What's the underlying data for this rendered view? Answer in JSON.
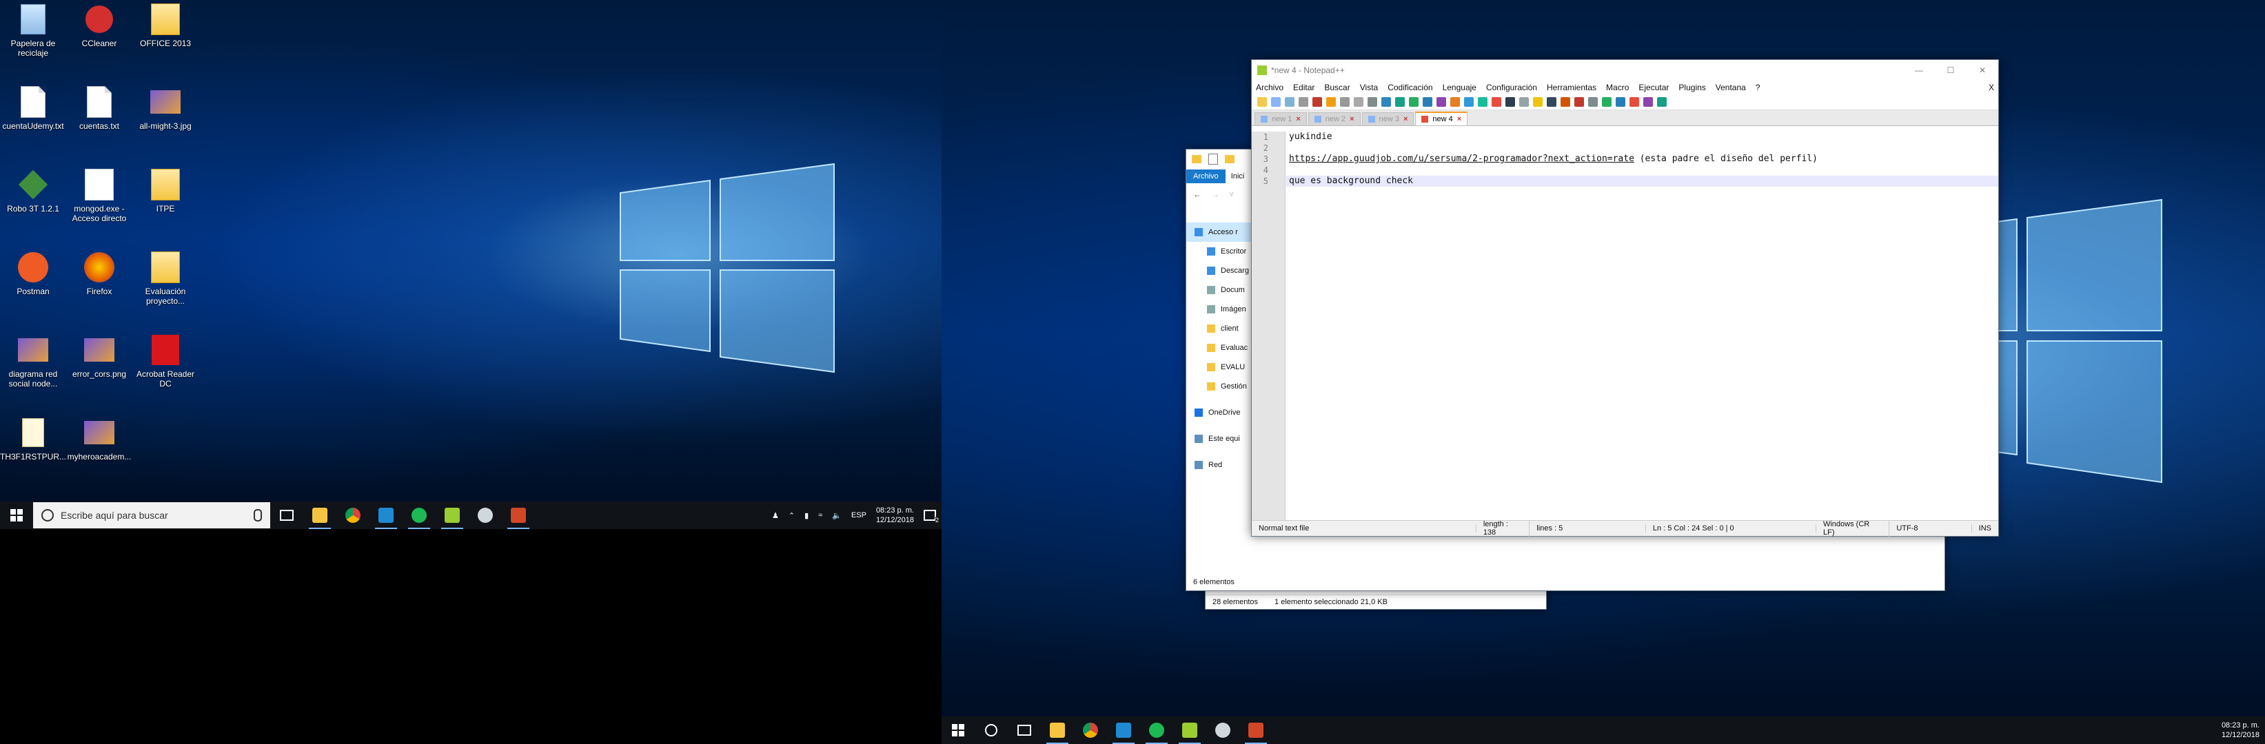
{
  "desktop1": {
    "icons": [
      {
        "label": "Papelera de reciclaje",
        "icon": "recycle-bin-icon"
      },
      {
        "label": "CCleaner",
        "icon": "ccleaner-icon"
      },
      {
        "label": "OFFICE 2013",
        "icon": "folder-icon"
      },
      {
        "label": "cuentaUdemy.txt",
        "icon": "text-file-icon"
      },
      {
        "label": "cuentas.txt",
        "icon": "text-file-icon"
      },
      {
        "label": "all-might-3.jpg",
        "icon": "image-file-icon"
      },
      {
        "label": "Robo 3T 1.2.1",
        "icon": "robo3t-icon"
      },
      {
        "label": "mongod.exe - Acceso directo",
        "icon": "mongodb-icon"
      },
      {
        "label": "ITPE",
        "icon": "folder-icon"
      },
      {
        "label": "Postman",
        "icon": "postman-icon"
      },
      {
        "label": "Firefox",
        "icon": "firefox-icon"
      },
      {
        "label": "Evaluación proyecto...",
        "icon": "folder-icon"
      },
      {
        "label": "diagrama red social node...",
        "icon": "image-file-icon"
      },
      {
        "label": "error_cors.png",
        "icon": "image-file-icon"
      },
      {
        "label": "Acrobat Reader DC",
        "icon": "acrobat-icon"
      },
      {
        "label": "TH3F1RSTPUR...",
        "icon": "file-icon"
      },
      {
        "label": "myheroacadem...",
        "icon": "image-file-icon"
      }
    ]
  },
  "taskbar1": {
    "search_placeholder": "Escribe aquí para buscar",
    "language": "ESP",
    "time": "08:23 p. m.",
    "date": "12/12/2018",
    "notification_count": "2"
  },
  "taskbar2": {
    "time": "08:23 p. m.",
    "date": "12/12/2018"
  },
  "explorer_back": {
    "status_items": "28 elementos",
    "status_selected": "1 elemento seleccionado  21,0 KB"
  },
  "explorer_front": {
    "ribbon_tab_active": "Archivo",
    "ribbon_tab_2": "Inici",
    "nav": [
      {
        "label": "Acceso r",
        "icon": "star-icon"
      },
      {
        "label": "Escritor",
        "icon": "desktop-icon"
      },
      {
        "label": "Descarg",
        "icon": "download-icon"
      },
      {
        "label": "Docum",
        "icon": "document-icon"
      },
      {
        "label": "Imágen",
        "icon": "picture-icon"
      },
      {
        "label": "client",
        "icon": "folder-icon"
      },
      {
        "label": "Evaluac",
        "icon": "folder-icon"
      },
      {
        "label": "EVALU",
        "icon": "folder-icon"
      },
      {
        "label": "Gestión",
        "icon": "folder-icon"
      },
      {
        "label": "OneDrive",
        "icon": "onedrive-icon"
      },
      {
        "label": "Este equi",
        "icon": "computer-icon"
      },
      {
        "label": "Red",
        "icon": "network-icon"
      }
    ],
    "status_items": "6 elementos"
  },
  "notepad": {
    "title": "*new 4 - Notepad++",
    "menu": [
      "Archivo",
      "Editar",
      "Buscar",
      "Vista",
      "Codificación",
      "Lenguaje",
      "Configuración",
      "Herramientas",
      "Macro",
      "Ejecutar",
      "Plugins",
      "Ventana",
      "?"
    ],
    "menu_close": "X",
    "tabs": [
      {
        "label": "new 1"
      },
      {
        "label": "new 2"
      },
      {
        "label": "new 3"
      },
      {
        "label": "new 4",
        "active": true
      }
    ],
    "lines": [
      {
        "num": "1",
        "text": "yukindie"
      },
      {
        "num": "2",
        "text": ""
      },
      {
        "num": "3",
        "text": "https://app.guudjob.com/u/sersuma/2-programador?next_action=rate",
        "suffix": " (esta padre el diseño del perfil)"
      },
      {
        "num": "4",
        "text": ""
      },
      {
        "num": "5",
        "text": "que es background check"
      }
    ],
    "status": {
      "type": "Normal text file",
      "length": "length : 138",
      "lines": "lines : 5",
      "pos": "Ln : 5    Col : 24    Sel : 0 | 0",
      "eol": "Windows (CR LF)",
      "enc": "UTF-8",
      "mode": "INS"
    }
  }
}
